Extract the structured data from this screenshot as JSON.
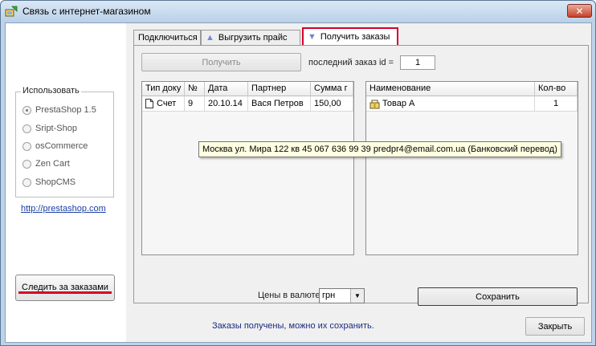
{
  "window": {
    "title": "Связь с интернет-магазином",
    "close_glyph": "✕"
  },
  "platforms": {
    "group_title": "Использовать",
    "items": [
      {
        "label": "PrestaShop 1.5",
        "checked": true
      },
      {
        "label": "Sript-Shop",
        "checked": false
      },
      {
        "label": "osCommerce",
        "checked": false
      },
      {
        "label": "Zen Cart",
        "checked": false
      },
      {
        "label": "ShopCMS",
        "checked": false
      }
    ],
    "link": "http://prestashop.com"
  },
  "follow_button": "Следить за заказами",
  "tabs": [
    {
      "label": "Подключиться",
      "icon": "",
      "active": false
    },
    {
      "label": "Выгрузить прайс",
      "icon": "arrow-up-icon",
      "active": false
    },
    {
      "label": "Получить заказы",
      "icon": "arrow-down-icon",
      "active": true
    }
  ],
  "orders_tab": {
    "get_button": "Получить",
    "last_order_label": "последний заказ id =",
    "last_order_id": "1",
    "orders_table": {
      "headers": [
        "Тип доку",
        "№",
        "Дата",
        "Партнер",
        "Сумма г"
      ],
      "rows": [
        {
          "type": "Счет",
          "number": "9",
          "date": "20.10.14",
          "partner": "Вася Петров",
          "sum": "150,00"
        }
      ]
    },
    "items_table": {
      "headers": [
        "Наименование",
        "Кол-во"
      ],
      "rows": [
        {
          "name": "Товар А",
          "qty": "1"
        }
      ]
    },
    "tooltip": "Москва ул. Мира 122 кв 45  067 636 99 39 predpr4@email.com.ua  (Банковский перевод)",
    "currency_label": "Цены в валюте",
    "currency_value": "грн",
    "save_button": "Сохранить"
  },
  "status_text": "Заказы получены, можно их сохранить.",
  "close_button": "Закрыть",
  "colors": {
    "accent_red": "#d6002a",
    "link_blue": "#1a3fa6",
    "tooltip_bg": "#ffffe1"
  }
}
